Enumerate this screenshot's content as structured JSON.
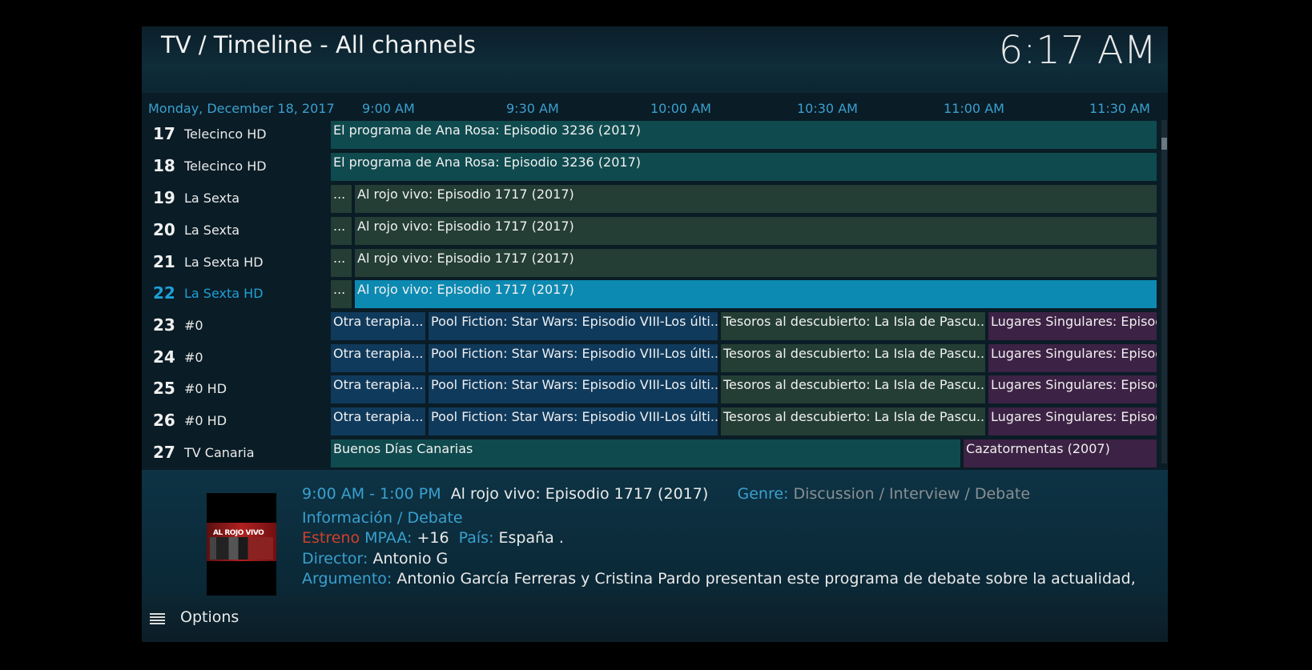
{
  "header": {
    "title": "TV / Timeline - All channels",
    "clock": "6:17 AM"
  },
  "timeline": {
    "date": "Monday, December 18, 2017",
    "times": [
      "9:00 AM",
      "9:30 AM",
      "10:00 AM",
      "10:30 AM",
      "11:00 AM",
      "11:30 AM"
    ]
  },
  "channels": [
    {
      "number": "17",
      "name": "Telecinco HD"
    },
    {
      "number": "18",
      "name": "Telecinco HD"
    },
    {
      "number": "19",
      "name": "La Sexta"
    },
    {
      "number": "20",
      "name": "La Sexta"
    },
    {
      "number": "21",
      "name": "La Sexta HD"
    },
    {
      "number": "22",
      "name": "La Sexta HD",
      "selected": true
    },
    {
      "number": "23",
      "name": "#0"
    },
    {
      "number": "24",
      "name": "#0"
    },
    {
      "number": "25",
      "name": "#0 HD"
    },
    {
      "number": "26",
      "name": "#0 HD"
    },
    {
      "number": "27",
      "name": "TV Canaria"
    }
  ],
  "programs": {
    "ana_rosa": "El programa de Ana Rosa: Episodio 3236 (2017)",
    "ellipsis": "...",
    "rojo_vivo": "Al rojo vivo: Episodio 1717 (2017)",
    "otra_terapia": "Otra terapia...",
    "pool_fiction": "Pool Fiction: Star Wars: Episodio VIII-Los últi...",
    "tesoros": "Tesoros al descubierto: La Isla de Pascu...",
    "lugares": "Lugares Singulares: Episodio",
    "buenos_dias": "Buenos Días Canarias",
    "cazatormentas": "Cazatormentas (2007)"
  },
  "colors": {
    "teal": "#0f4a4e",
    "green": "#243e35",
    "blue": "#103a5c",
    "purple": "#3c2244",
    "selected": "#0c8ab2",
    "accent": "#3aa0cf"
  },
  "info": {
    "thumbnail_icon": "al-rojo-vivo-thumbnail",
    "thumbnail_text": "AL ROJO VIVO",
    "time_range": "9:00 AM - 1:00 PM",
    "title": "Al rojo vivo: Episodio 1717 (2017)",
    "genre_label": "Genre:",
    "genre": "Discussion / Interview / Debate",
    "category": "Información / Debate",
    "estreno": "Estreno",
    "mpaa_label": "MPAA:",
    "mpaa": "+16",
    "pais_label": "País:",
    "pais": "España .",
    "director_label": "Director:",
    "director": "Antonio G",
    "argumento_label": "Argumento:",
    "argumento": "Antonio García Ferreras y Cristina Pardo presentan este programa de debate sobre la actualidad,"
  },
  "options": {
    "icon": "menu-icon",
    "label": "Options"
  }
}
